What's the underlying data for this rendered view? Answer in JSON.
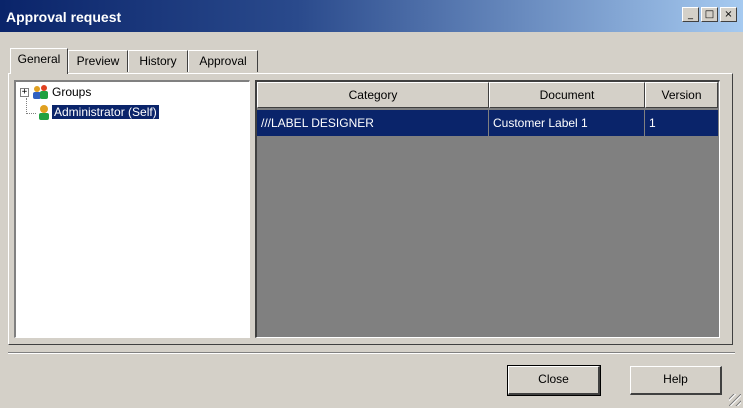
{
  "window": {
    "title": "Approval request",
    "minimize_glyph": "_",
    "maximize_glyph": "□",
    "close_glyph": "×"
  },
  "tabs": [
    {
      "label": "General",
      "active": true
    },
    {
      "label": "Preview",
      "active": false
    },
    {
      "label": "History",
      "active": false
    },
    {
      "label": "Approval",
      "active": false
    }
  ],
  "tree": {
    "expander_glyph": "+",
    "items": [
      {
        "label": "Groups",
        "icon": "users-group-icon",
        "selected": false
      },
      {
        "label": "Administrator (Self)",
        "icon": "user-icon",
        "selected": true
      }
    ]
  },
  "grid": {
    "columns": [
      "Category",
      "Document",
      "Version"
    ],
    "rows": [
      {
        "category": "///LABEL DESIGNER",
        "document": "Customer Label 1",
        "version": "1",
        "selected": true
      }
    ]
  },
  "buttons": {
    "close_label": "Close",
    "help_label": "Help"
  },
  "colors": {
    "title_bar": "#0a246a",
    "selection": "#0a246a",
    "dialog_face": "#d4d0c8",
    "grid_background": "#808080"
  }
}
